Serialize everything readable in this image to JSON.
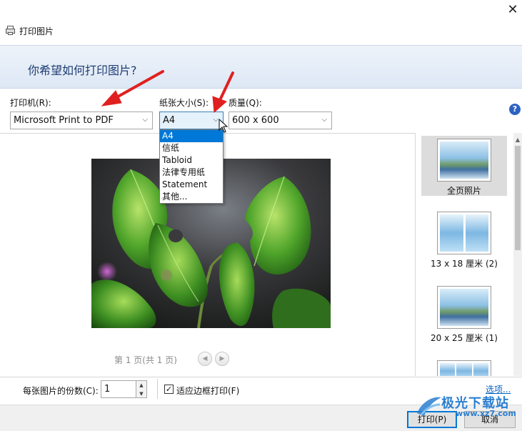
{
  "window": {
    "title": "打印图片",
    "close_glyph": "✕"
  },
  "header": {
    "question": "你希望如何打印图片?"
  },
  "printer": {
    "label": "打印机(R):",
    "value": "Microsoft Print to PDF"
  },
  "paper_size": {
    "label": "纸张大小(S):",
    "value": "A4",
    "options": [
      "A4",
      "信纸",
      "Tabloid",
      "法律专用纸",
      "Statement",
      "其他..."
    ],
    "selected_index": 0
  },
  "quality": {
    "label": "质量(Q):",
    "value": "600 x 600"
  },
  "help": {
    "glyph": "?"
  },
  "preview": {
    "page_info": "第 1 页(共 1 页)",
    "prev_glyph": "◀",
    "next_glyph": "▶"
  },
  "layouts": [
    {
      "label": "全页照片",
      "selected": true
    },
    {
      "label": "13 x 18 厘米 (2)",
      "selected": false
    },
    {
      "label": "20 x 25 厘米 (1)",
      "selected": false
    }
  ],
  "copies": {
    "label": "每张图片的份数(C):",
    "value": "1"
  },
  "fit_to_frame": {
    "label": "适应边框打印(F)",
    "checked": true,
    "check_glyph": "✓"
  },
  "options_link": "选项...",
  "buttons": {
    "print": "打印(P)",
    "cancel": "取消"
  },
  "watermark": {
    "name": "极光下载站",
    "url": "www.xz7.com"
  },
  "colors": {
    "header_text": "#1f3d73",
    "dropdown_highlight": "#0078d7",
    "annotation_arrow": "#e02020",
    "link": "#0563c1"
  }
}
